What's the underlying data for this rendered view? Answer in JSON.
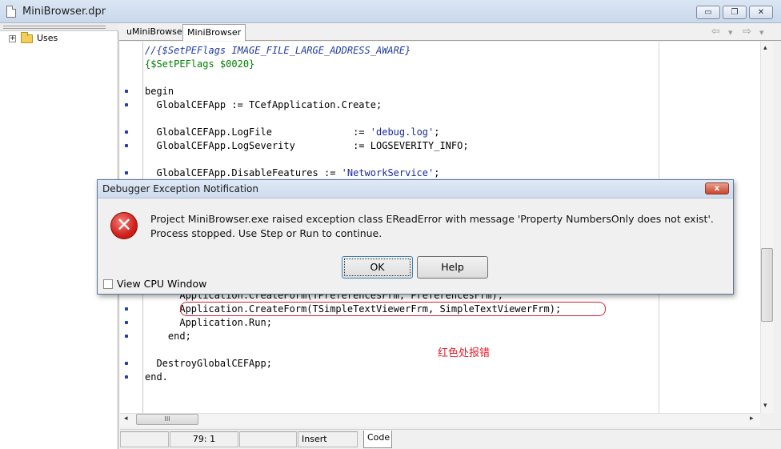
{
  "window": {
    "title": "MiniBrowser.dpr"
  },
  "icons": {
    "document": "document-icon",
    "minimize": "minimize-icon",
    "maximize": "maximize-icon",
    "close": "close-icon",
    "folder": "folder-icon",
    "expand": "plus-icon",
    "back": "arrow-left-icon",
    "forward": "arrow-right-icon",
    "error": "error-icon"
  },
  "window_buttons": {
    "minimize": "▭",
    "maximize": "❐",
    "close": "✕"
  },
  "tree": {
    "expand_symbol": "+",
    "items": [
      {
        "label": "Uses"
      }
    ]
  },
  "tabs": [
    {
      "label": "uMiniBrowser"
    },
    {
      "label": "MiniBrowser",
      "active": true
    }
  ],
  "nav": {
    "back": "⇦",
    "back_dropdown": "▾",
    "forward": "⇨",
    "forward_dropdown": "▾"
  },
  "code": {
    "lines": [
      {
        "text": "//{$SetPEFlags IMAGE_FILE_LARGE_ADDRESS_AWARE}"
      },
      {
        "text": "{$SetPEFlags $0020}"
      },
      {
        "text": "begin"
      },
      {
        "text": "  GlobalCEFApp := TCefApplication.Create;"
      },
      {
        "text": "  GlobalCEFApp.LogFile              := "
      },
      {
        "text": "'debug.log'"
      },
      {
        "text": ";"
      },
      {
        "text": "  GlobalCEFApp.LogSeverity          := LOGSEVERITY_INFO;"
      },
      {
        "text": "  GlobalCEFApp.DisableFeatures := "
      },
      {
        "text": "'NetworkService'"
      },
      {
        "text": ";"
      },
      {
        "text": "      Application.CreateForm(TPreferencesFrm, PreferencesFrm);"
      },
      {
        "text": "      Application.CreateForm(TSimpleTextViewerFrm, SimpleTextViewerFrm);"
      },
      {
        "text": "      Application.Run;"
      },
      {
        "text": "    end;"
      },
      {
        "text": "  DestroyGlobalCEFApp;"
      },
      {
        "text": "end."
      }
    ],
    "annotation": "红色处报错"
  },
  "scrollbars": {
    "hthumb": "III",
    "left_arrow": "◂",
    "right_arrow": "▸",
    "up_arrow": "▴",
    "down_arrow": "▾"
  },
  "statusbar": {
    "position": "79:  1",
    "mode": "Insert",
    "view_tab": "Code"
  },
  "dialog": {
    "title": "Debugger Exception Notification",
    "close_symbol": "x",
    "error_symbol": "✕",
    "message": "Project MiniBrowser.exe raised exception class EReadError with message 'Property NumbersOnly does not exist'. Process stopped. Use Step or Run to continue.",
    "ok_label": "OK",
    "help_label": "Help",
    "checkbox_label": "View CPU Window",
    "checkbox_checked": false
  }
}
